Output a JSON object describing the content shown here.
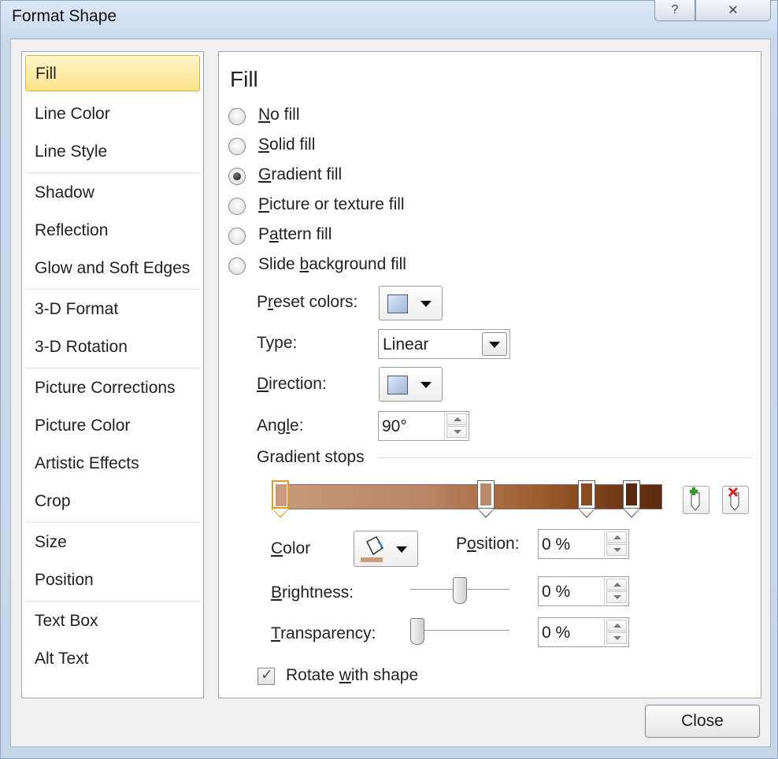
{
  "window": {
    "title": "Format Shape",
    "help_glyph": "?",
    "close_glyph": "✕"
  },
  "nav": {
    "items": [
      {
        "label": "Fill",
        "selected": true
      },
      {
        "label": "Line Color"
      },
      {
        "label": "Line Style"
      },
      {
        "label": "Shadow"
      },
      {
        "label": "Reflection"
      },
      {
        "label": "Glow and Soft Edges"
      },
      {
        "label": "3-D Format"
      },
      {
        "label": "3-D Rotation"
      },
      {
        "label": "Picture Corrections"
      },
      {
        "label": "Picture Color"
      },
      {
        "label": "Artistic Effects"
      },
      {
        "label": "Crop"
      },
      {
        "label": "Size"
      },
      {
        "label": "Position"
      },
      {
        "label": "Text Box"
      },
      {
        "label": "Alt Text"
      }
    ]
  },
  "fill": {
    "heading": "Fill",
    "options": {
      "no_fill": {
        "hot": "N",
        "rest": "o fill",
        "checked": false
      },
      "solid_fill": {
        "hot": "S",
        "rest": "olid fill",
        "checked": false
      },
      "gradient_fill": {
        "hot": "G",
        "rest": "radient fill",
        "checked": true
      },
      "picture_fill": {
        "hot": "P",
        "rest": "icture or texture fill",
        "checked": false
      },
      "pattern_fill": {
        "pre": "P",
        "hot": "a",
        "rest": "ttern fill",
        "checked": false
      },
      "slide_bg_fill": {
        "pre": "Slide ",
        "hot": "b",
        "rest": "ackground fill",
        "checked": false
      }
    },
    "preset_colors": {
      "pre": "P",
      "hot": "r",
      "rest": "eset colors:"
    },
    "type": {
      "label": "Type:",
      "value": "Linear"
    },
    "direction": {
      "hot": "D",
      "rest": "irection:"
    },
    "angle": {
      "pre": "Ang",
      "hot": "l",
      "rest": "e:",
      "value": "90°"
    },
    "gradient_stops_label": "Gradient stops",
    "stops": [
      {
        "position": 0,
        "color": "#c99a7e",
        "selected": true
      },
      {
        "position": 0.55,
        "color": "#b98a6e",
        "selected": false
      },
      {
        "position": 0.82,
        "color": "#8a4a22",
        "selected": false
      },
      {
        "position": 0.94,
        "color": "#5a2a10",
        "selected": false
      }
    ],
    "color_label": {
      "hot": "C",
      "rest": "olor"
    },
    "position": {
      "pre": "P",
      "hot": "o",
      "rest": "sition:",
      "value": "0 %"
    },
    "brightness": {
      "hot": "B",
      "rest": "rightness:",
      "value": "0 %",
      "level": 0.5
    },
    "transparency": {
      "hot": "T",
      "rest": "ransparency:",
      "value": "0 %",
      "level": 0
    },
    "rotate_with_shape": {
      "pre": "Rotate ",
      "hot": "w",
      "rest": "ith shape",
      "checked": true
    }
  },
  "buttons": {
    "close": "Close"
  },
  "colors": {
    "selected_item": "#fbe48a",
    "selected_stop_border": "#e39a2e"
  }
}
